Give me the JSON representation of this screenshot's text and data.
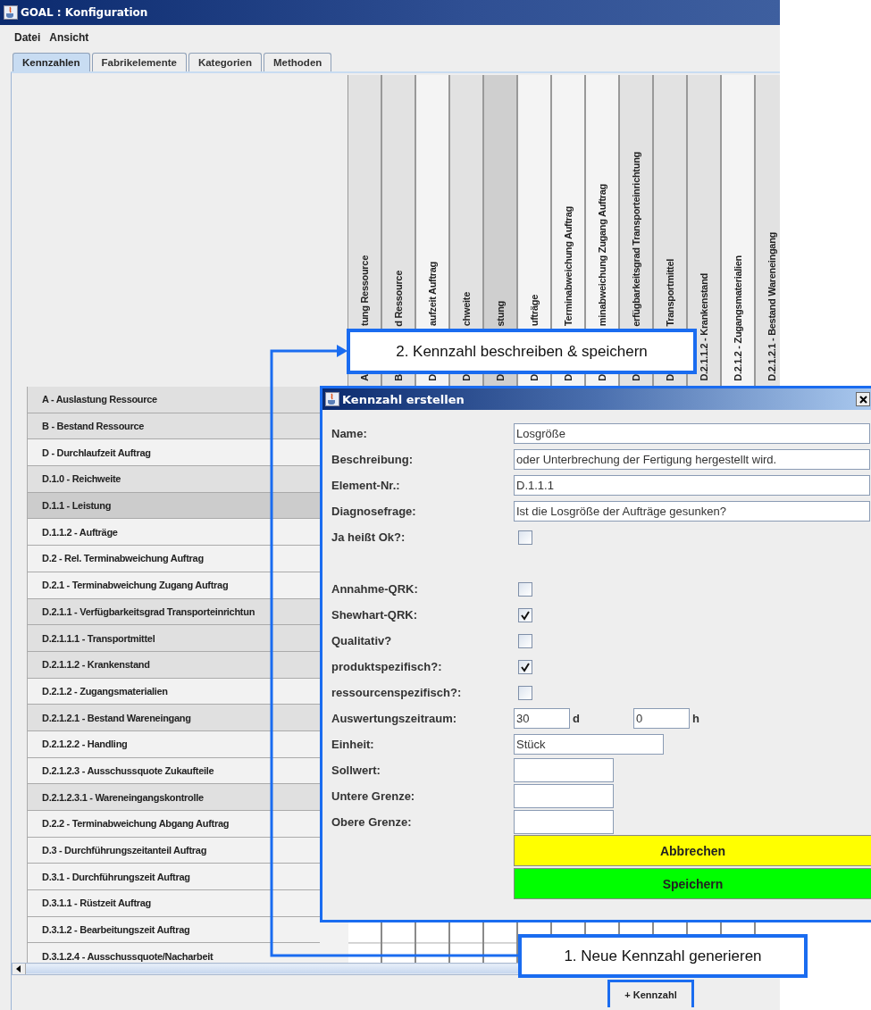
{
  "window": {
    "title": "GOAL : Konfiguration"
  },
  "menu": [
    "Datei",
    "Ansicht"
  ],
  "tabs": [
    {
      "label": "Kennzahlen",
      "selected": true
    },
    {
      "label": "Fabrikelemente",
      "selected": false
    },
    {
      "label": "Kategorien",
      "selected": false
    },
    {
      "label": "Methoden",
      "selected": false
    }
  ],
  "table": {
    "columns": [
      {
        "top": "tung Ressource",
        "bottom": "A",
        "shaded": true,
        "selected": false
      },
      {
        "top": "d Ressource",
        "bottom": "B",
        "shaded": true,
        "selected": false
      },
      {
        "top": "aufzeit Auftrag",
        "bottom": "D",
        "shaded": false,
        "selected": false
      },
      {
        "top": "chweite",
        "bottom": "D",
        "shaded": true,
        "selected": false
      },
      {
        "top": "stung",
        "bottom": "D",
        "shaded": true,
        "selected": true
      },
      {
        "top": "ufträge",
        "bottom": "D",
        "shaded": false,
        "selected": false
      },
      {
        "top": "Terminabweichung Auftrag",
        "bottom": "D",
        "shaded": false,
        "selected": false
      },
      {
        "top": "minabweichung Zugang Auftrag",
        "bottom": "D",
        "shaded": false,
        "selected": false
      },
      {
        "top": "erfügbarkeitsgrad Transporteinrichtung",
        "bottom": "D",
        "shaded": true,
        "selected": false
      },
      {
        "top": "Transportmittel",
        "bottom": "D",
        "shaded": true,
        "selected": false
      },
      {
        "top": "D.2.1.1.2 - Krankenstand",
        "shaded": true,
        "selected": false
      },
      {
        "top": "D.2.1.2 - Zugangsmaterialien",
        "shaded": false,
        "selected": false
      },
      {
        "top": "D.2.1.2.1 - Bestand Wareneingang",
        "shaded": true,
        "selected": false
      }
    ],
    "rows": [
      {
        "label": "A - Auslastung Ressource",
        "shaded": true,
        "selected": false
      },
      {
        "label": "B - Bestand Ressource",
        "shaded": true,
        "selected": false
      },
      {
        "label": "D - Durchlaufzeit Auftrag",
        "shaded": false,
        "selected": false
      },
      {
        "label": "D.1.0 - Reichweite",
        "shaded": true,
        "selected": false
      },
      {
        "label": "D.1.1 - Leistung",
        "shaded": true,
        "selected": true
      },
      {
        "label": "D.1.1.2 - Aufträge",
        "shaded": false,
        "selected": false
      },
      {
        "label": "D.2 - Rel. Terminabweichung Auftrag",
        "shaded": false,
        "selected": false
      },
      {
        "label": "D.2.1 - Terminabweichung Zugang Auftrag",
        "shaded": false,
        "selected": false
      },
      {
        "label": "D.2.1.1 - Verfügbarkeitsgrad Transporteinrichtun",
        "shaded": true,
        "selected": false
      },
      {
        "label": "D.2.1.1.1 - Transportmittel",
        "shaded": true,
        "selected": false
      },
      {
        "label": "D.2.1.1.2 - Krankenstand",
        "shaded": true,
        "selected": false
      },
      {
        "label": "D.2.1.2 - Zugangsmaterialien",
        "shaded": false,
        "selected": false
      },
      {
        "label": "D.2.1.2.1 - Bestand Wareneingang",
        "shaded": true,
        "selected": false
      },
      {
        "label": "D.2.1.2.2 - Handling",
        "shaded": false,
        "selected": false
      },
      {
        "label": "D.2.1.2.3 - Ausschussquote Zukaufteile",
        "shaded": false,
        "selected": false
      },
      {
        "label": "D.2.1.2.3.1 - Wareneingangskontrolle",
        "shaded": true,
        "selected": false
      },
      {
        "label": "D.2.2 - Terminabweichung Abgang Auftrag",
        "shaded": false,
        "selected": false
      },
      {
        "label": "D.3 - Durchführungszeitanteil Auftrag",
        "shaded": false,
        "selected": false
      },
      {
        "label": "D.3.1 - Durchführungszeit Auftrag",
        "shaded": false,
        "selected": false
      },
      {
        "label": "D.3.1.1 - Rüstzeit Auftrag",
        "shaded": false,
        "selected": false
      },
      {
        "label": "D.3.1.2 - Bearbeitungszeit Auftrag",
        "shaded": false,
        "selected": false
      },
      {
        "label": "D.3.1.2.4 - Ausschussquote/Nacharbeit",
        "shaded": false,
        "selected": false
      }
    ]
  },
  "dialog": {
    "title": "Kennzahl erstellen",
    "fields": [
      {
        "kind": "text",
        "label": "Name:",
        "value": "Losgröße"
      },
      {
        "kind": "text",
        "label": "Beschreibung:",
        "value": " oder Unterbrechung der Fertigung hergestellt wird."
      },
      {
        "kind": "text",
        "label": "Element-Nr.:",
        "value": "D.1.1.1"
      },
      {
        "kind": "text",
        "label": "Diagnosefrage:",
        "value": "Ist die Losgröße der Aufträge gesunken?"
      },
      {
        "kind": "checkbox",
        "label": "Ja heißt Ok?:",
        "checked": false
      }
    ],
    "options": [
      {
        "kind": "checkbox",
        "label": "Annahme-QRK:",
        "checked": false
      },
      {
        "kind": "checkbox",
        "label": "Shewhart-QRK:",
        "checked": true
      },
      {
        "kind": "checkbox",
        "label": "Qualitativ?",
        "checked": false
      },
      {
        "kind": "checkbox",
        "label": "produktspezifisch?:",
        "checked": true
      },
      {
        "kind": "checkbox",
        "label": "ressourcenspezifisch?:",
        "checked": false
      },
      {
        "kind": "duration",
        "label": "Auswertungszeitraum:",
        "value": "30",
        "unit": "d",
        "value_2": "0",
        "unit_2": "h"
      },
      {
        "kind": "short",
        "label": "Einheit:",
        "value": "Stück"
      },
      {
        "kind": "number",
        "label": "Sollwert:"
      },
      {
        "kind": "number",
        "label": "Untere Grenze:"
      },
      {
        "kind": "number",
        "label": "Obere Grenze:"
      }
    ],
    "buttons": [
      {
        "kind": "cancel",
        "label": "Abbrechen"
      },
      {
        "kind": "save",
        "label": "Speichern"
      }
    ]
  },
  "callouts": [
    {
      "text": "2. Kennzahl beschreiben & speichern"
    },
    {
      "text": "1. Neue Kennzahl generieren"
    }
  ],
  "add_button": {
    "label": "+ Kennzahl"
  }
}
